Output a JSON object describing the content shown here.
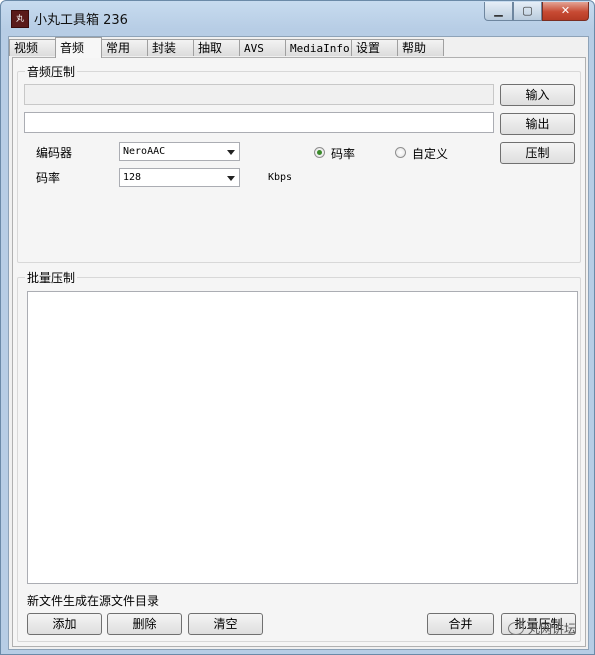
{
  "window": {
    "title": "小丸工具箱 236",
    "icon_text": "丸"
  },
  "tabs": [
    {
      "label": "视频"
    },
    {
      "label": "音频"
    },
    {
      "label": "常用"
    },
    {
      "label": "封装"
    },
    {
      "label": "抽取"
    },
    {
      "label": "AVS"
    },
    {
      "label": "MediaInfo"
    },
    {
      "label": "设置"
    },
    {
      "label": "帮助"
    }
  ],
  "active_tab": "音频",
  "audio": {
    "group_title": "音频压制",
    "input_button": "输入",
    "output_button": "输出",
    "encode_button": "压制",
    "input_path": "",
    "output_path": "",
    "encoder_label": "编码器",
    "encoder_value": "NeroAAC",
    "bitrate_label": "码率",
    "bitrate_value": "128",
    "bitrate_unit": "Kbps",
    "radio_bitrate": "码率",
    "radio_custom": "自定义",
    "selected_mode": "码率"
  },
  "batch": {
    "group_title": "批量压制",
    "files": [],
    "note": "新文件生成在源文件目录",
    "add_button": "添加",
    "delete_button": "删除",
    "clear_button": "清空",
    "merge_button": "合并",
    "batch_button": "批量压制"
  },
  "watermark": {
    "text": "丸网讲坛"
  },
  "colors": {
    "accent": "#3a8a2a",
    "close": "#c74a33"
  }
}
